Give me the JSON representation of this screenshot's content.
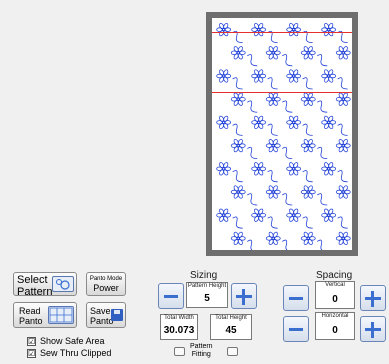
{
  "buttons": {
    "select_pattern": [
      "Select",
      "Pattern"
    ],
    "panto_mode": [
      "Panto Mode",
      "Power"
    ],
    "read_panto": [
      "Read",
      "Panto"
    ],
    "save_panto": [
      "Save",
      "Panto"
    ]
  },
  "checkboxes": [
    {
      "label": "Show Safe Area",
      "checked_glyph": "☑"
    },
    {
      "label": "Sew Thru Clipped",
      "checked_glyph": "☑"
    }
  ],
  "sizing": {
    "title": "Sizing",
    "pattern_height_label": "Pattern Height",
    "pattern_height_value": "5",
    "total_width_label": "Total Width",
    "total_width_value": "30.073",
    "total_height_label": "Total Height",
    "total_height_value": "45",
    "pattern_fitting_label": [
      "Pattern",
      "Fitting"
    ]
  },
  "spacing": {
    "title": "Spacing",
    "vertical_label": "Vertical",
    "vertical_value": "0",
    "horizontal_label": "Horizontal",
    "horizontal_value": "0"
  },
  "colors": {
    "stitch": "#1f3fd6",
    "safe_area_line": "#e53030",
    "frame": "#6e6e6e"
  }
}
